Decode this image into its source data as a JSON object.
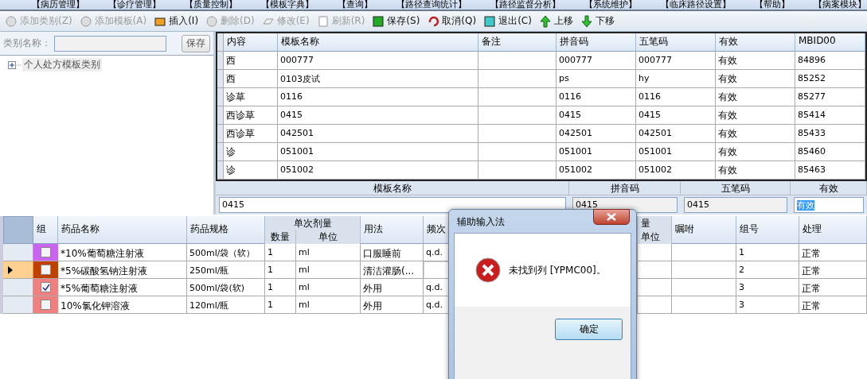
{
  "menu": [
    "【病历管理】",
    "【诊疗管理】",
    "【质量控制】",
    "【模板字典】",
    "【查询】",
    "【路径查询统计】",
    "【路径监督分析】",
    "【系统维护】",
    "【临床路径设置】",
    "【帮助】",
    "【病案模块】"
  ],
  "toolbar": [
    {
      "label": "添加类别(Z)",
      "disabled": true
    },
    {
      "label": "添加模板(A)",
      "disabled": true
    },
    {
      "label": "插入(I)",
      "disabled": false
    },
    {
      "label": "删除(D)",
      "disabled": true
    },
    {
      "label": "修改(E)",
      "disabled": true
    },
    {
      "label": "刷新(R)",
      "disabled": true
    },
    {
      "label": "保存(S)",
      "disabled": false
    },
    {
      "label": "取消(Q)",
      "disabled": false
    },
    {
      "label": "退出(C)",
      "disabled": false
    },
    {
      "label": "上移",
      "disabled": false
    },
    {
      "label": "下移",
      "disabled": false
    }
  ],
  "category": {
    "label": "类别名称：",
    "save_button": "保存"
  },
  "tree": [
    {
      "label": "个人处方模板类别",
      "expanded": false
    }
  ],
  "templates": {
    "columns": [
      "内容",
      "模板名称",
      "备注",
      "拼音码",
      "五笔码",
      "有效",
      "MBID00"
    ],
    "rows": [
      [
        "西",
        "000777",
        "",
        "000777",
        "000777",
        "有效",
        "84896"
      ],
      [
        "西",
        "0103皮试",
        "",
        "ps",
        "hy",
        "有效",
        "85252"
      ],
      [
        "诊草",
        "0116",
        "",
        "0116",
        "0116",
        "有效",
        "85277"
      ],
      [
        "西诊草",
        "0415",
        "",
        "0415",
        "0415",
        "有效",
        "85414"
      ],
      [
        "西诊草",
        "042501",
        "",
        "042501",
        "042501",
        "有效",
        "85433"
      ],
      [
        "诊",
        "051001",
        "",
        "051001",
        "051001",
        "有效",
        "85460"
      ],
      [
        "诊",
        "051002",
        "",
        "051002",
        "051002",
        "有效",
        "85463"
      ]
    ]
  },
  "editor": [
    {
      "label": "模板名称",
      "value": "0415",
      "disabled": false,
      "selected": false
    },
    {
      "label": "拼音码",
      "value": "0415",
      "disabled": true,
      "selected": false
    },
    {
      "label": "五笔码",
      "value": "0415",
      "disabled": true,
      "selected": false
    },
    {
      "label": "有效",
      "value": "有效",
      "disabled": false,
      "selected": true
    }
  ],
  "orders": {
    "columns": {
      "group": "组",
      "name": "药品名称",
      "spec": "药品规格",
      "dose": "单次剂量",
      "qty": "数量",
      "unit": "单位",
      "usage": "用法",
      "freq": "频次",
      "column_8_top": "量",
      "column_8_bottom": "单位",
      "advice": "嘱咐",
      "group_no": "组号",
      "handling": "处理"
    },
    "rows": [
      {
        "current": false,
        "color": "#c864f0",
        "checked": false,
        "name": "*10%葡萄糖注射液",
        "spec": "500ml/袋（软）",
        "qty": "1",
        "unit": "ml",
        "usage": "口服睡前",
        "freq": "q.d.",
        "group_no": "1",
        "handling": "正常"
      },
      {
        "current": true,
        "color": "#c04000",
        "checked": false,
        "name": "*5%碳酸氢钠注射液",
        "spec": "250ml/瓶",
        "qty": "1",
        "unit": "ml",
        "usage": "清洁灌肠(...",
        "group_no": "2",
        "handling": "正常"
      },
      {
        "current": false,
        "color": "#f08080",
        "checked": true,
        "name": "*5%葡萄糖注射液",
        "spec": "500ml/袋(软)",
        "qty": "1",
        "unit": "ml",
        "usage": "外用",
        "freq": "q.d.",
        "group_no": "3",
        "handling": "正常"
      },
      {
        "current": false,
        "color": "#f08080",
        "checked": false,
        "name": "10%氯化钾溶液",
        "spec": "120ml/瓶",
        "qty": "1",
        "unit": "ml",
        "usage": "外用",
        "freq": "q.d.",
        "group_no": "3",
        "handling": "正常"
      }
    ]
  },
  "dialog": {
    "title": "辅助输入法",
    "message": "未找到列 [YPMC00]。",
    "ok_button": "确定"
  }
}
